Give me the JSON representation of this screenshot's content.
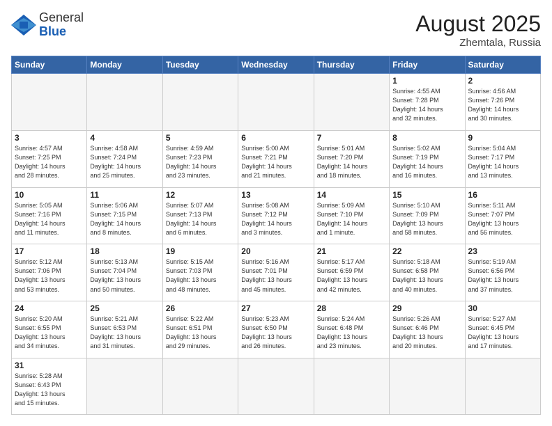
{
  "header": {
    "logo_general": "General",
    "logo_blue": "Blue",
    "month_year": "August 2025",
    "location": "Zhemtala, Russia"
  },
  "weekdays": [
    "Sunday",
    "Monday",
    "Tuesday",
    "Wednesday",
    "Thursday",
    "Friday",
    "Saturday"
  ],
  "weeks": [
    [
      {
        "num": "",
        "info": "",
        "empty": true
      },
      {
        "num": "",
        "info": "",
        "empty": true
      },
      {
        "num": "",
        "info": "",
        "empty": true
      },
      {
        "num": "",
        "info": "",
        "empty": true
      },
      {
        "num": "",
        "info": "",
        "empty": true
      },
      {
        "num": "1",
        "info": "Sunrise: 4:55 AM\nSunset: 7:28 PM\nDaylight: 14 hours\nand 32 minutes.",
        "empty": false
      },
      {
        "num": "2",
        "info": "Sunrise: 4:56 AM\nSunset: 7:26 PM\nDaylight: 14 hours\nand 30 minutes.",
        "empty": false
      }
    ],
    [
      {
        "num": "3",
        "info": "Sunrise: 4:57 AM\nSunset: 7:25 PM\nDaylight: 14 hours\nand 28 minutes.",
        "empty": false
      },
      {
        "num": "4",
        "info": "Sunrise: 4:58 AM\nSunset: 7:24 PM\nDaylight: 14 hours\nand 25 minutes.",
        "empty": false
      },
      {
        "num": "5",
        "info": "Sunrise: 4:59 AM\nSunset: 7:23 PM\nDaylight: 14 hours\nand 23 minutes.",
        "empty": false
      },
      {
        "num": "6",
        "info": "Sunrise: 5:00 AM\nSunset: 7:21 PM\nDaylight: 14 hours\nand 21 minutes.",
        "empty": false
      },
      {
        "num": "7",
        "info": "Sunrise: 5:01 AM\nSunset: 7:20 PM\nDaylight: 14 hours\nand 18 minutes.",
        "empty": false
      },
      {
        "num": "8",
        "info": "Sunrise: 5:02 AM\nSunset: 7:19 PM\nDaylight: 14 hours\nand 16 minutes.",
        "empty": false
      },
      {
        "num": "9",
        "info": "Sunrise: 5:04 AM\nSunset: 7:17 PM\nDaylight: 14 hours\nand 13 minutes.",
        "empty": false
      }
    ],
    [
      {
        "num": "10",
        "info": "Sunrise: 5:05 AM\nSunset: 7:16 PM\nDaylight: 14 hours\nand 11 minutes.",
        "empty": false
      },
      {
        "num": "11",
        "info": "Sunrise: 5:06 AM\nSunset: 7:15 PM\nDaylight: 14 hours\nand 8 minutes.",
        "empty": false
      },
      {
        "num": "12",
        "info": "Sunrise: 5:07 AM\nSunset: 7:13 PM\nDaylight: 14 hours\nand 6 minutes.",
        "empty": false
      },
      {
        "num": "13",
        "info": "Sunrise: 5:08 AM\nSunset: 7:12 PM\nDaylight: 14 hours\nand 3 minutes.",
        "empty": false
      },
      {
        "num": "14",
        "info": "Sunrise: 5:09 AM\nSunset: 7:10 PM\nDaylight: 14 hours\nand 1 minute.",
        "empty": false
      },
      {
        "num": "15",
        "info": "Sunrise: 5:10 AM\nSunset: 7:09 PM\nDaylight: 13 hours\nand 58 minutes.",
        "empty": false
      },
      {
        "num": "16",
        "info": "Sunrise: 5:11 AM\nSunset: 7:07 PM\nDaylight: 13 hours\nand 56 minutes.",
        "empty": false
      }
    ],
    [
      {
        "num": "17",
        "info": "Sunrise: 5:12 AM\nSunset: 7:06 PM\nDaylight: 13 hours\nand 53 minutes.",
        "empty": false
      },
      {
        "num": "18",
        "info": "Sunrise: 5:13 AM\nSunset: 7:04 PM\nDaylight: 13 hours\nand 50 minutes.",
        "empty": false
      },
      {
        "num": "19",
        "info": "Sunrise: 5:15 AM\nSunset: 7:03 PM\nDaylight: 13 hours\nand 48 minutes.",
        "empty": false
      },
      {
        "num": "20",
        "info": "Sunrise: 5:16 AM\nSunset: 7:01 PM\nDaylight: 13 hours\nand 45 minutes.",
        "empty": false
      },
      {
        "num": "21",
        "info": "Sunrise: 5:17 AM\nSunset: 6:59 PM\nDaylight: 13 hours\nand 42 minutes.",
        "empty": false
      },
      {
        "num": "22",
        "info": "Sunrise: 5:18 AM\nSunset: 6:58 PM\nDaylight: 13 hours\nand 40 minutes.",
        "empty": false
      },
      {
        "num": "23",
        "info": "Sunrise: 5:19 AM\nSunset: 6:56 PM\nDaylight: 13 hours\nand 37 minutes.",
        "empty": false
      }
    ],
    [
      {
        "num": "24",
        "info": "Sunrise: 5:20 AM\nSunset: 6:55 PM\nDaylight: 13 hours\nand 34 minutes.",
        "empty": false
      },
      {
        "num": "25",
        "info": "Sunrise: 5:21 AM\nSunset: 6:53 PM\nDaylight: 13 hours\nand 31 minutes.",
        "empty": false
      },
      {
        "num": "26",
        "info": "Sunrise: 5:22 AM\nSunset: 6:51 PM\nDaylight: 13 hours\nand 29 minutes.",
        "empty": false
      },
      {
        "num": "27",
        "info": "Sunrise: 5:23 AM\nSunset: 6:50 PM\nDaylight: 13 hours\nand 26 minutes.",
        "empty": false
      },
      {
        "num": "28",
        "info": "Sunrise: 5:24 AM\nSunset: 6:48 PM\nDaylight: 13 hours\nand 23 minutes.",
        "empty": false
      },
      {
        "num": "29",
        "info": "Sunrise: 5:26 AM\nSunset: 6:46 PM\nDaylight: 13 hours\nand 20 minutes.",
        "empty": false
      },
      {
        "num": "30",
        "info": "Sunrise: 5:27 AM\nSunset: 6:45 PM\nDaylight: 13 hours\nand 17 minutes.",
        "empty": false
      }
    ],
    [
      {
        "num": "31",
        "info": "Sunrise: 5:28 AM\nSunset: 6:43 PM\nDaylight: 13 hours\nand 15 minutes.",
        "empty": false
      },
      {
        "num": "",
        "info": "",
        "empty": true
      },
      {
        "num": "",
        "info": "",
        "empty": true
      },
      {
        "num": "",
        "info": "",
        "empty": true
      },
      {
        "num": "",
        "info": "",
        "empty": true
      },
      {
        "num": "",
        "info": "",
        "empty": true
      },
      {
        "num": "",
        "info": "",
        "empty": true
      }
    ]
  ]
}
